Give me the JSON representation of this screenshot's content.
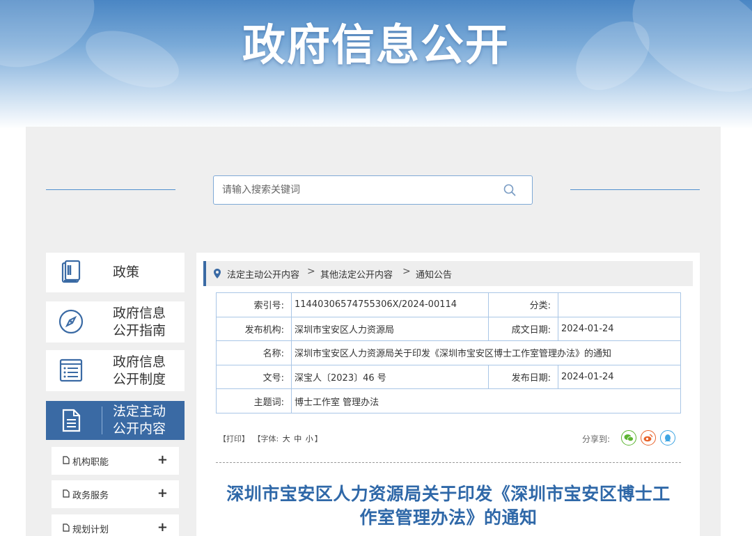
{
  "banner": {
    "title": "政府信息公开"
  },
  "search": {
    "placeholder": "请输入搜索关键词"
  },
  "sidebar": {
    "items": [
      {
        "label": "政策",
        "icon": "book-icon"
      },
      {
        "label": "政府信息\n公开指南",
        "icon": "compass-icon"
      },
      {
        "label": "政府信息\n公开制度",
        "icon": "list-icon"
      },
      {
        "label": "法定主动\n公开内容",
        "icon": "document-icon",
        "active": true
      }
    ],
    "sub_items": [
      {
        "label": "机构职能",
        "toggle": "+"
      },
      {
        "label": "政务服务",
        "toggle": "+"
      },
      {
        "label": "规划计划",
        "toggle": "+"
      }
    ]
  },
  "breadcrumb": {
    "items": [
      "法定主动公开内容",
      "其他法定公开内容",
      "通知公告"
    ],
    "separator": ">"
  },
  "meta": {
    "index_label": "索引号:",
    "index_value": "11440306574755306X/2024-00114",
    "category_label": "分类:",
    "category_value": "",
    "publisher_label": "发布机构:",
    "publisher_value": "深圳市宝安区人力资源局",
    "created_label": "成文日期:",
    "created_value": "2024-01-24",
    "name_label": "名称:",
    "name_value": "深圳市宝安区人力资源局关于印发《深圳市宝安区博士工作室管理办法》的通知",
    "docno_label": "文号:",
    "docno_value": "深宝人〔2023〕46 号",
    "published_label": "发布日期:",
    "published_value": "2024-01-24",
    "subject_label": "主题词:",
    "subject_value": "博士工作室 管理办法"
  },
  "tools": {
    "print": "【打印】",
    "font_prefix": "【字体:",
    "font_large": "大",
    "font_medium": "中",
    "font_small": "小",
    "font_suffix": "】",
    "share_label": "分享到:"
  },
  "share": [
    {
      "name": "wechat",
      "color": "#5cb531"
    },
    {
      "name": "weibo",
      "color": "#e8642c"
    },
    {
      "name": "qq",
      "color": "#3ea5e3"
    }
  ],
  "document": {
    "title_line1": "深圳市宝安区人力资源局关于印发《深圳市宝安区博士工",
    "title_line2": "作室管理办法》的通知"
  },
  "colors": {
    "accent": "#3a6aa4",
    "title": "#2f68a8",
    "border": "#a9c6e6"
  }
}
